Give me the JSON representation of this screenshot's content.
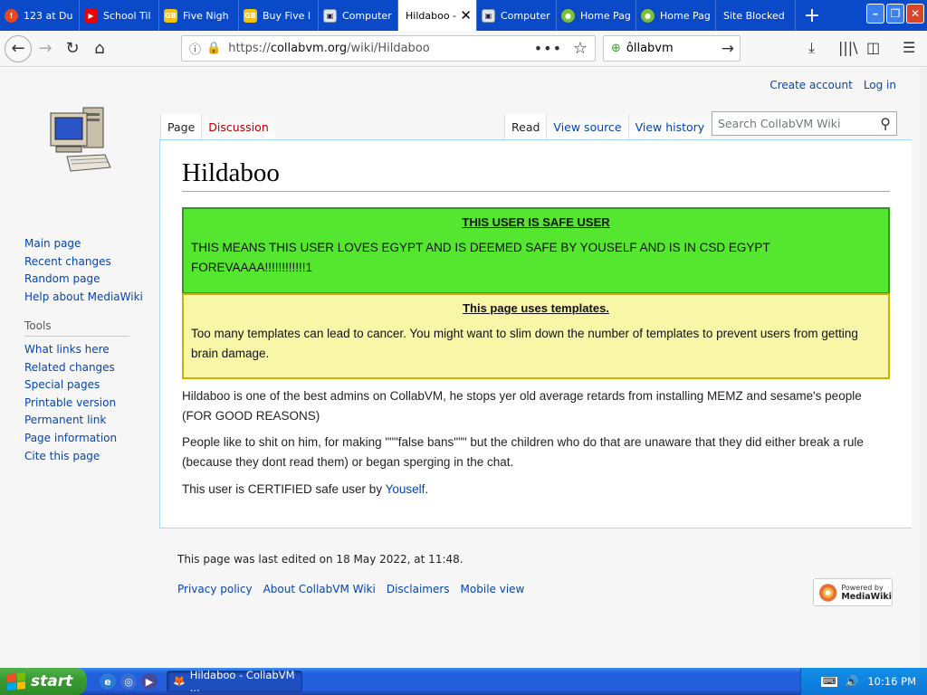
{
  "browser": {
    "tabs": [
      {
        "label": "123 at Du",
        "icon": "circle-icon"
      },
      {
        "label": "School Til",
        "icon": "youtube-icon"
      },
      {
        "label": "Five Nigh",
        "icon": "gamebanana-icon"
      },
      {
        "label": "Buy Five I",
        "icon": "gamebanana-icon"
      },
      {
        "label": "Computer",
        "icon": "computer-icon"
      },
      {
        "label": "Hildaboo -",
        "icon": "none",
        "active": true
      },
      {
        "label": "Computer",
        "icon": "computer-icon"
      },
      {
        "label": "Home Pag",
        "icon": "globe-icon"
      },
      {
        "label": "Home Pag",
        "icon": "globe-icon"
      },
      {
        "label": "Site Blocked",
        "icon": "none"
      }
    ],
    "new_tab": "+",
    "url_prefix": "https://",
    "url_host": "collabvm.org",
    "url_path": "/wiki/Hildaboo",
    "search_value": "ôllabvm"
  },
  "wiki": {
    "personal": {
      "create_account": "Create account",
      "login": "Log in"
    },
    "nav": [
      "Main page",
      "Recent changes",
      "Random page",
      "Help about MediaWiki"
    ],
    "tools_heading": "Tools",
    "tools": [
      "What links here",
      "Related changes",
      "Special pages",
      "Printable version",
      "Permanent link",
      "Page information",
      "Cite this page"
    ],
    "tabs_left": {
      "page": "Page",
      "discussion": "Discussion"
    },
    "tabs_right": {
      "read": "Read",
      "view_source": "View source",
      "view_history": "View history"
    },
    "search_placeholder": "Search CollabVM Wiki",
    "title": "Hildaboo",
    "box1": {
      "heading": "THIS USER IS SAFE USER",
      "text": "THIS MEANS THIS USER LOVES EGYPT AND IS DEEMED SAFE BY YOUSELF AND IS IN CSD EGYPT FOREVAAAA!!!!!!!!!!!!1",
      "color": "#55e62f"
    },
    "box2": {
      "heading": "This page uses templates.",
      "text": "Too many templates can lead to cancer. You might want to slim down the number of templates to prevent users from getting brain damage.",
      "color": "#f8f7a8"
    },
    "para1": "Hildaboo is one of the best admins on CollabVM, he stops yer old average retards from installing MEMZ and sesame's people (FOR GOOD REASONS)",
    "para2": "People like to shit on him, for making \"\"\"false bans\"\"\" but the children who do that are unaware that they did either break a rule (because they dont read them) or began sperging in the chat.",
    "para3_prefix": "This user is CERTIFIED safe user by ",
    "para3_link": "Youself",
    "para3_suffix": ".",
    "last_edited": "This page was last edited on 18 May 2022, at 11:48.",
    "footer_links": [
      "Privacy policy",
      "About CollabVM Wiki",
      "Disclaimers",
      "Mobile view"
    ],
    "badge": {
      "powered": "Powered by",
      "name": "MediaWiki"
    }
  },
  "taskbar": {
    "start": "start",
    "task": "Hildaboo - CollabVM ...",
    "clock": "10:16 PM"
  }
}
